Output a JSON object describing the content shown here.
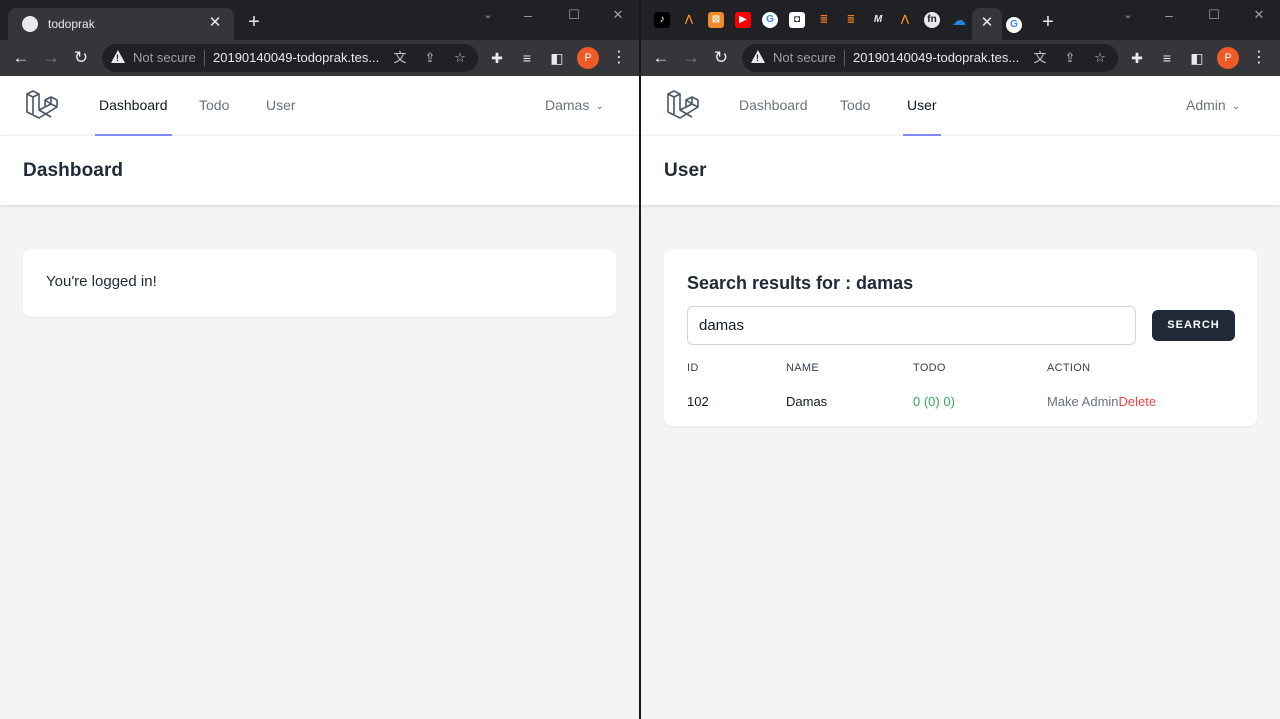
{
  "left": {
    "tab_title": "todoprak",
    "omnibox": {
      "security": "Not secure",
      "url": "20190140049-todoprak.tes..."
    },
    "profile_initial": "P",
    "nav": {
      "links": [
        "Dashboard",
        "Todo",
        "User"
      ],
      "active": "Dashboard",
      "user": "Damas"
    },
    "header": "Dashboard",
    "card_text": "You're logged in!"
  },
  "right": {
    "omnibox": {
      "security": "Not secure",
      "url": "20190140049-todoprak.tes..."
    },
    "profile_initial": "P",
    "nav": {
      "links": [
        "Dashboard",
        "Todo",
        "User"
      ],
      "active": "User",
      "user": "Admin"
    },
    "header": "User",
    "search": {
      "title": "Search results for : damas",
      "value": "damas",
      "button": "SEARCH"
    },
    "table": {
      "headers": [
        "ID",
        "NAME",
        "TODO",
        "ACTION"
      ],
      "rows": [
        {
          "id": "102",
          "name": "Damas",
          "todo": "0 (0) 0)",
          "make_admin": "Make Admin",
          "delete": "Delete"
        }
      ]
    }
  },
  "colors": {
    "accent": "#818cf8",
    "dark_button": "#1f2937",
    "delete": "#ef4444",
    "todo": "#34a853",
    "avatar": "#f05a28"
  }
}
